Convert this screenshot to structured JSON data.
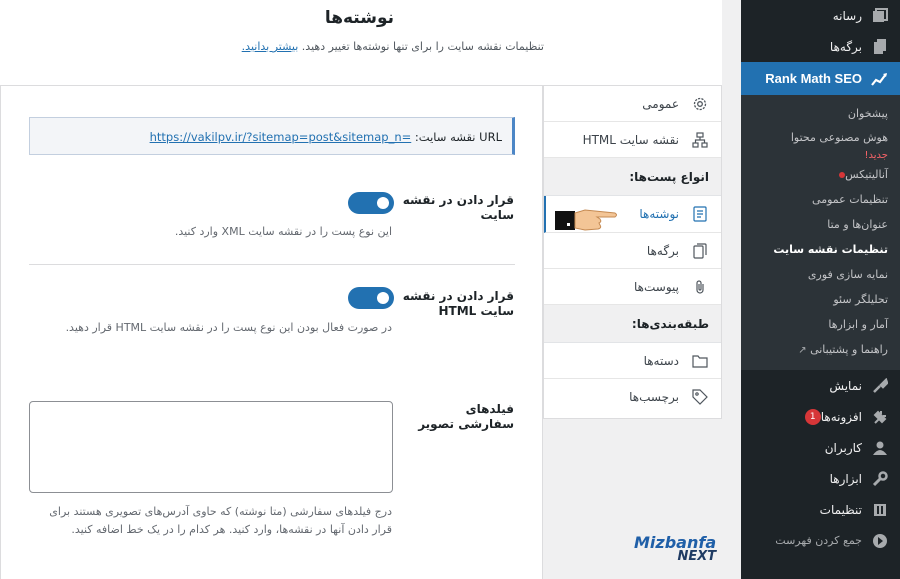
{
  "page": {
    "title": "نوشته‌ها",
    "description": "تنظیمات نقشه سایت را برای تنها نوشته‌ها تغییر دهید.",
    "learn_more": "بیشتر بدانید."
  },
  "admin_menu": {
    "top_items": [
      {
        "label": "رسانه",
        "icon": "media-icon"
      },
      {
        "label": "برگه‌ها",
        "icon": "pages-icon"
      }
    ],
    "active_item": {
      "label": "Rank Math SEO",
      "icon": "rank-math-icon"
    },
    "sub_items": [
      {
        "label": "پیشخوان"
      },
      {
        "label": "هوش مصنوعی محتوا",
        "badge": "جدید!"
      },
      {
        "label": "آنالیتیکس"
      },
      {
        "label": "تنظیمات عمومی"
      },
      {
        "label": "عنوان‌ها و متا"
      },
      {
        "label": "تنظیمات نقشه سایت",
        "current": true
      },
      {
        "label": "نمایه سازی فوری"
      },
      {
        "label": "تحلیلگر سئو"
      },
      {
        "label": "آمار و ابزارها"
      },
      {
        "label": "راهنما و پشتیبانی"
      }
    ],
    "bottom_items": [
      {
        "label": "نمایش",
        "icon": "appearance-icon"
      },
      {
        "label": "افزونه‌ها",
        "icon": "plugins-icon",
        "count": "1"
      },
      {
        "label": "کاربران",
        "icon": "users-icon"
      },
      {
        "label": "ابزارها",
        "icon": "tools-icon"
      },
      {
        "label": "تنظیمات",
        "icon": "settings-icon"
      },
      {
        "label": "جمع کردن فهرست",
        "icon": "collapse-icon"
      }
    ]
  },
  "settings_nav": {
    "general": "عمومی",
    "html_sitemap": "نقشه سایت HTML",
    "post_types_header": "انواع پست‌ها:",
    "posts": "نوشته‌ها",
    "pages": "برگه‌ها",
    "attachments": "پیوست‌ها",
    "taxonomies_header": "طبقه‌بندی‌ها:",
    "categories": "دسته‌ها",
    "tags": "برچسب‌ها"
  },
  "form": {
    "sitemap_url_label": "URL نقشه سایت:",
    "sitemap_url": "https://vakilpv.ir/?sitemap=post&sitemap_n=",
    "include_xml": {
      "label": "قرار دادن در نقشه سایت",
      "description": "این نوع پست را در نقشه سایت XML وارد کنید.",
      "enabled": true
    },
    "include_html": {
      "label": "قرار دادن در نقشه سایت HTML",
      "description": "در صورت فعال بودن این نوع پست را در نقشه سایت HTML قرار دهید.",
      "enabled": true
    },
    "image_fields": {
      "label": "فیلدهای سفارشی تصویر",
      "value": "",
      "description": "درج فیلدهای سفارشی (متا نوشته) که حاوی آدرس‌های تصویری هستند برای قرار دادن آنها در نقشه‌ها، وارد کنید. هر کدام را در یک خط اضافه کنید."
    }
  },
  "watermark": {
    "line1": "Mizbanfa",
    "line2": "NEXT"
  }
}
